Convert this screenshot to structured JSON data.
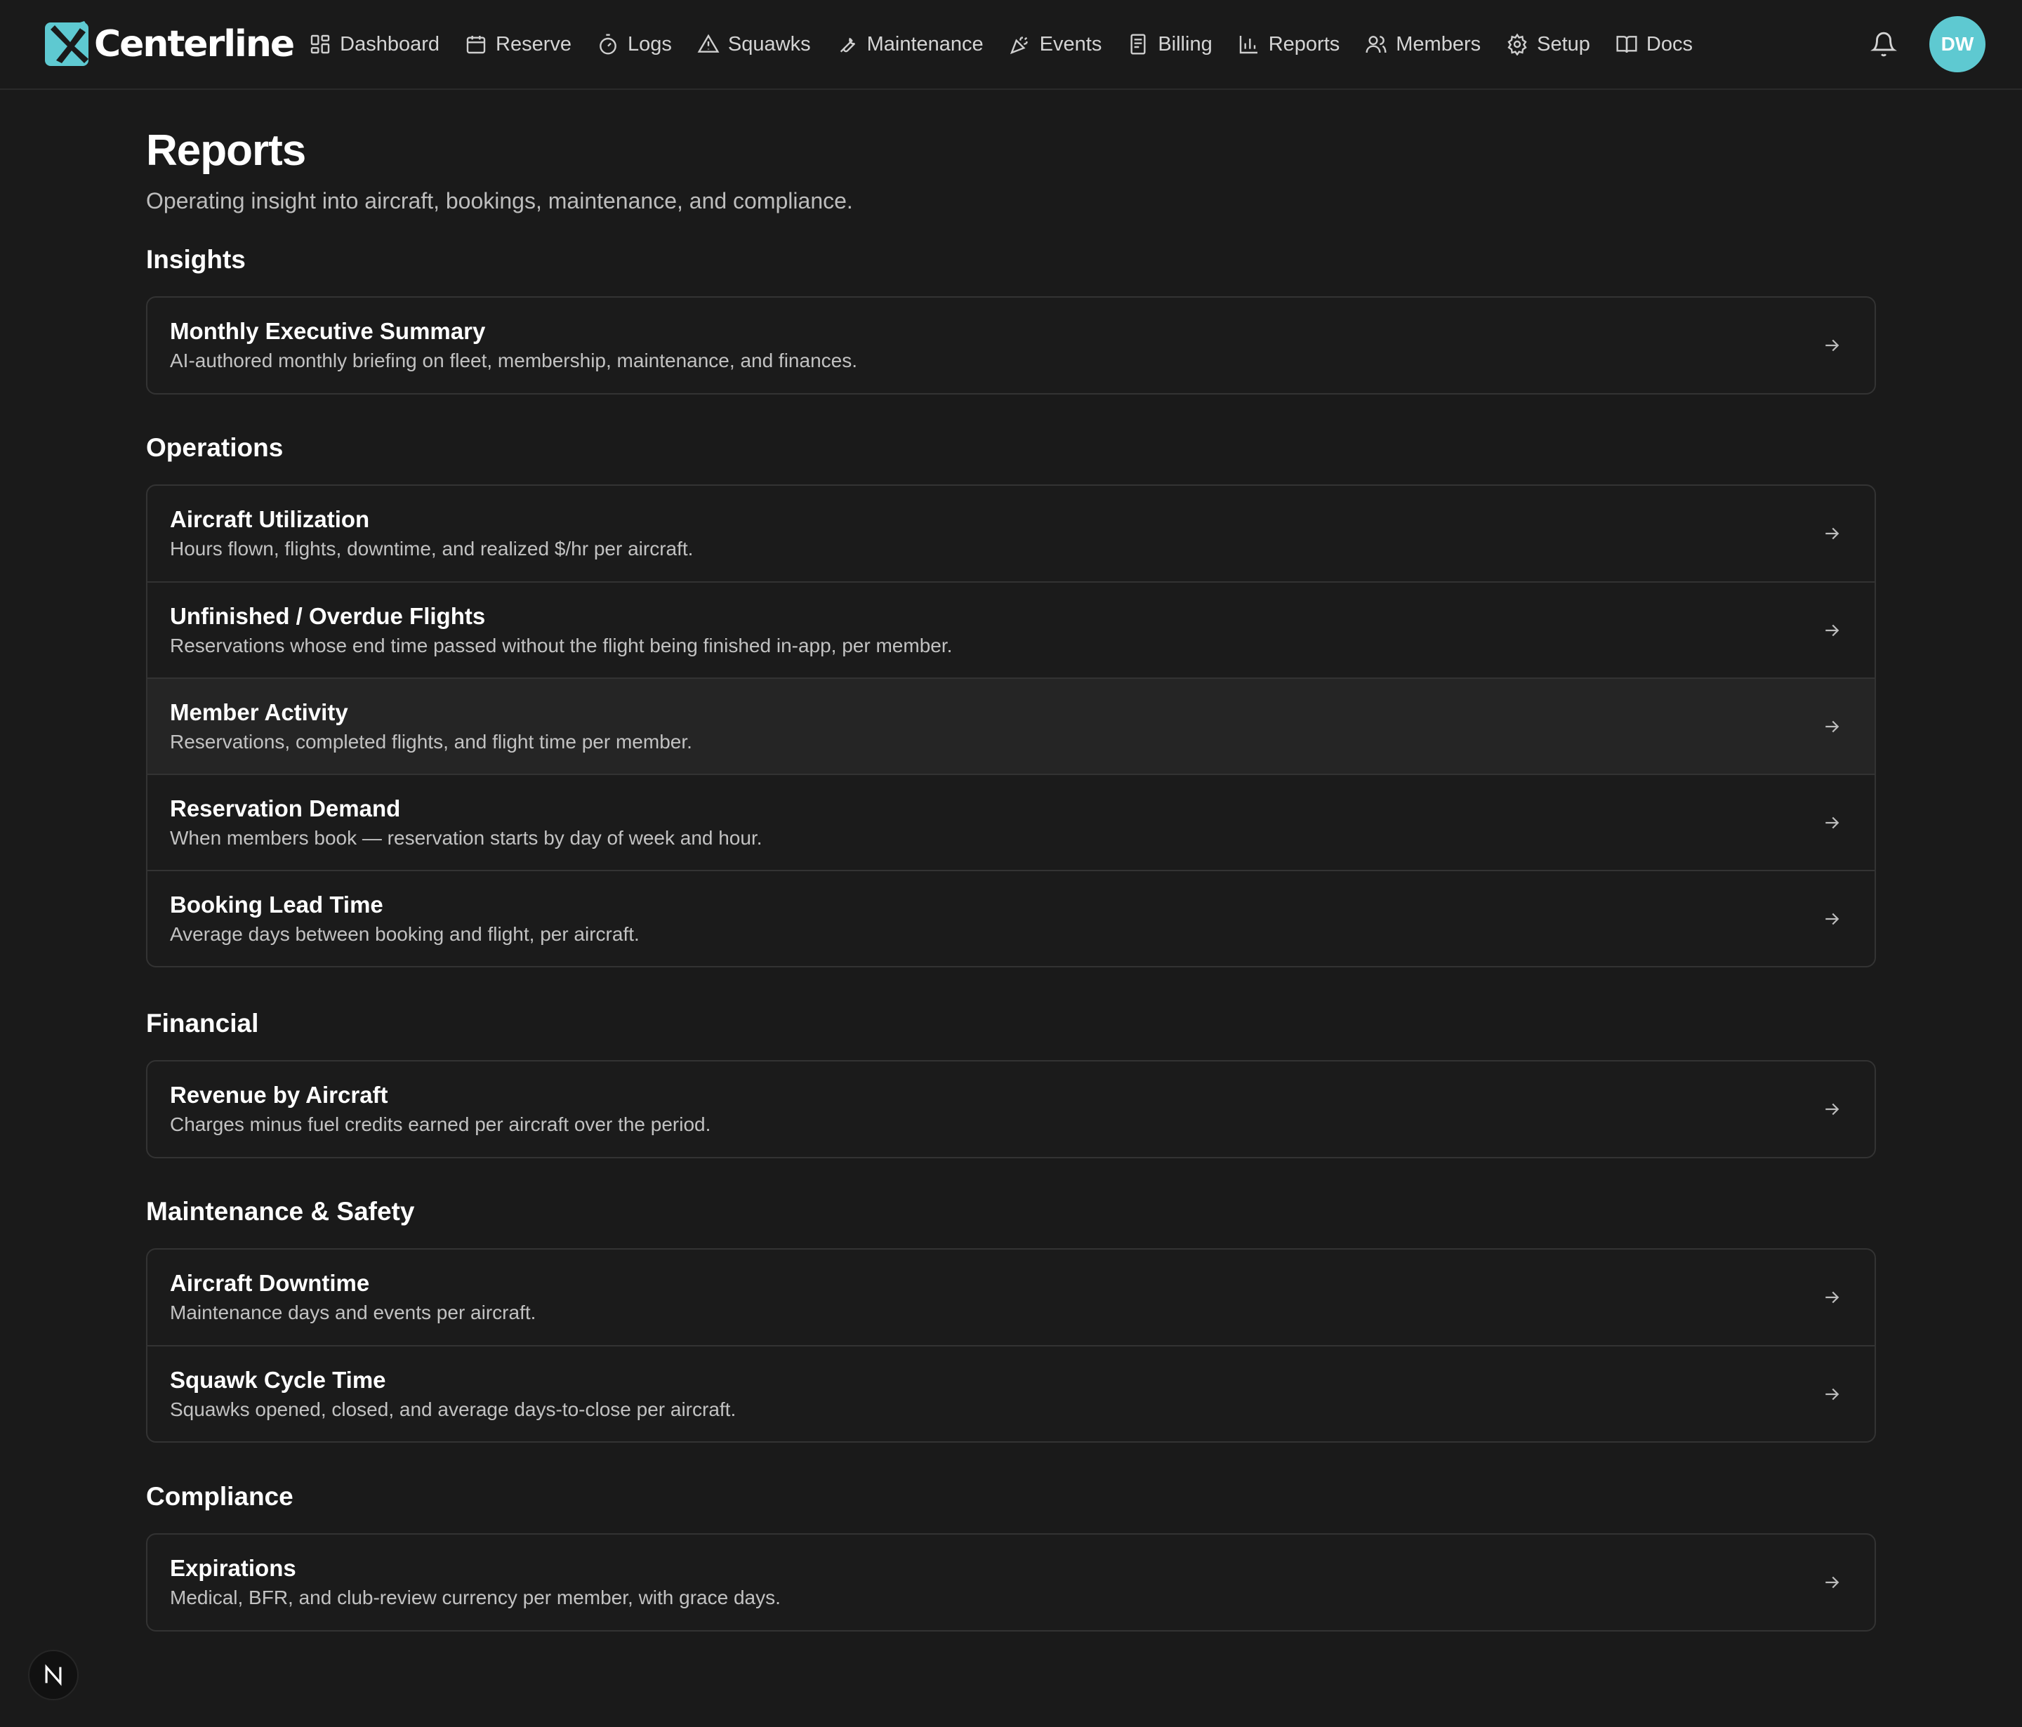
{
  "brand": {
    "name": "Centerline",
    "accent": "#5ec9d1"
  },
  "nav": {
    "items": [
      {
        "label": "Dashboard",
        "icon": "grid-icon"
      },
      {
        "label": "Reserve",
        "icon": "calendar-icon"
      },
      {
        "label": "Logs",
        "icon": "stopwatch-icon"
      },
      {
        "label": "Squawks",
        "icon": "warning-triangle-icon"
      },
      {
        "label": "Maintenance",
        "icon": "wrench-icon"
      },
      {
        "label": "Events",
        "icon": "party-popper-icon"
      },
      {
        "label": "Billing",
        "icon": "receipt-icon"
      },
      {
        "label": "Reports",
        "icon": "bar-chart-icon"
      },
      {
        "label": "Members",
        "icon": "users-icon"
      },
      {
        "label": "Setup",
        "icon": "gear-icon"
      },
      {
        "label": "Docs",
        "icon": "book-icon"
      }
    ],
    "notifications_icon": "bell-icon",
    "user_initials": "DW"
  },
  "page": {
    "title": "Reports",
    "subtitle": "Operating insight into aircraft, bookings, maintenance, and compliance."
  },
  "sections": [
    {
      "title": "Insights",
      "items": [
        {
          "title": "Monthly Executive Summary",
          "description": "AI-authored monthly briefing on fleet, membership, maintenance, and finances."
        }
      ]
    },
    {
      "title": "Operations",
      "items": [
        {
          "title": "Aircraft Utilization",
          "description": "Hours flown, flights, downtime, and realized $/hr per aircraft."
        },
        {
          "title": "Unfinished / Overdue Flights",
          "description": "Reservations whose end time passed without the flight being finished in-app, per member."
        },
        {
          "title": "Member Activity",
          "description": "Reservations, completed flights, and flight time per member."
        },
        {
          "title": "Reservation Demand",
          "description": "When members book — reservation starts by day of week and hour."
        },
        {
          "title": "Booking Lead Time",
          "description": "Average days between booking and flight, per aircraft."
        }
      ]
    },
    {
      "title": "Financial",
      "items": [
        {
          "title": "Revenue by Aircraft",
          "description": "Charges minus fuel credits earned per aircraft over the period."
        }
      ]
    },
    {
      "title": "Maintenance & Safety",
      "items": [
        {
          "title": "Aircraft Downtime",
          "description": "Maintenance days and events per aircraft."
        },
        {
          "title": "Squawk Cycle Time",
          "description": "Squawks opened, closed, and average days-to-close per aircraft."
        }
      ]
    },
    {
      "title": "Compliance",
      "items": [
        {
          "title": "Expirations",
          "description": "Medical, BFR, and club-review currency per member, with grace days."
        }
      ]
    }
  ]
}
